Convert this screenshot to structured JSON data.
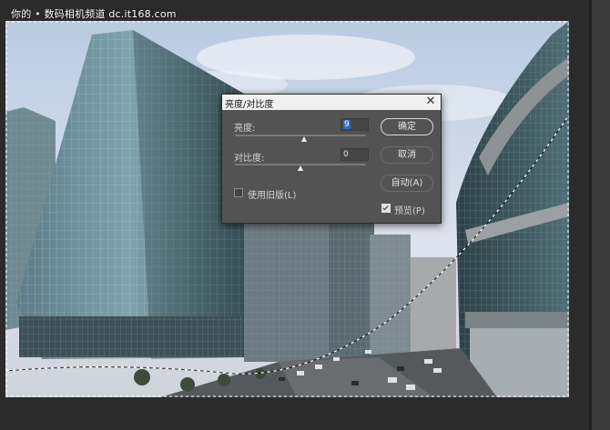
{
  "watermark": "你的 • 数码相机频道 dc.it168.com",
  "dialog": {
    "title": "亮度/对比度",
    "brightness": {
      "label": "亮度:",
      "value": "9",
      "slider": 0.53
    },
    "contrast": {
      "label": "对比度:",
      "value": "0",
      "slider": 0.5
    },
    "use_legacy": {
      "label": "使用旧版(L)",
      "checked": false
    },
    "preview": {
      "label": "预览(P)",
      "checked": true
    },
    "buttons": {
      "ok": "确定",
      "cancel": "取消",
      "auto": "自动(A)"
    }
  },
  "colors": {
    "workspace": "#2b2b2b",
    "dialog_bg": "#535353",
    "selection_blue": "#2d6cc7"
  },
  "icons": {
    "close": "close-icon",
    "checkbox": "checkbox-icon"
  }
}
